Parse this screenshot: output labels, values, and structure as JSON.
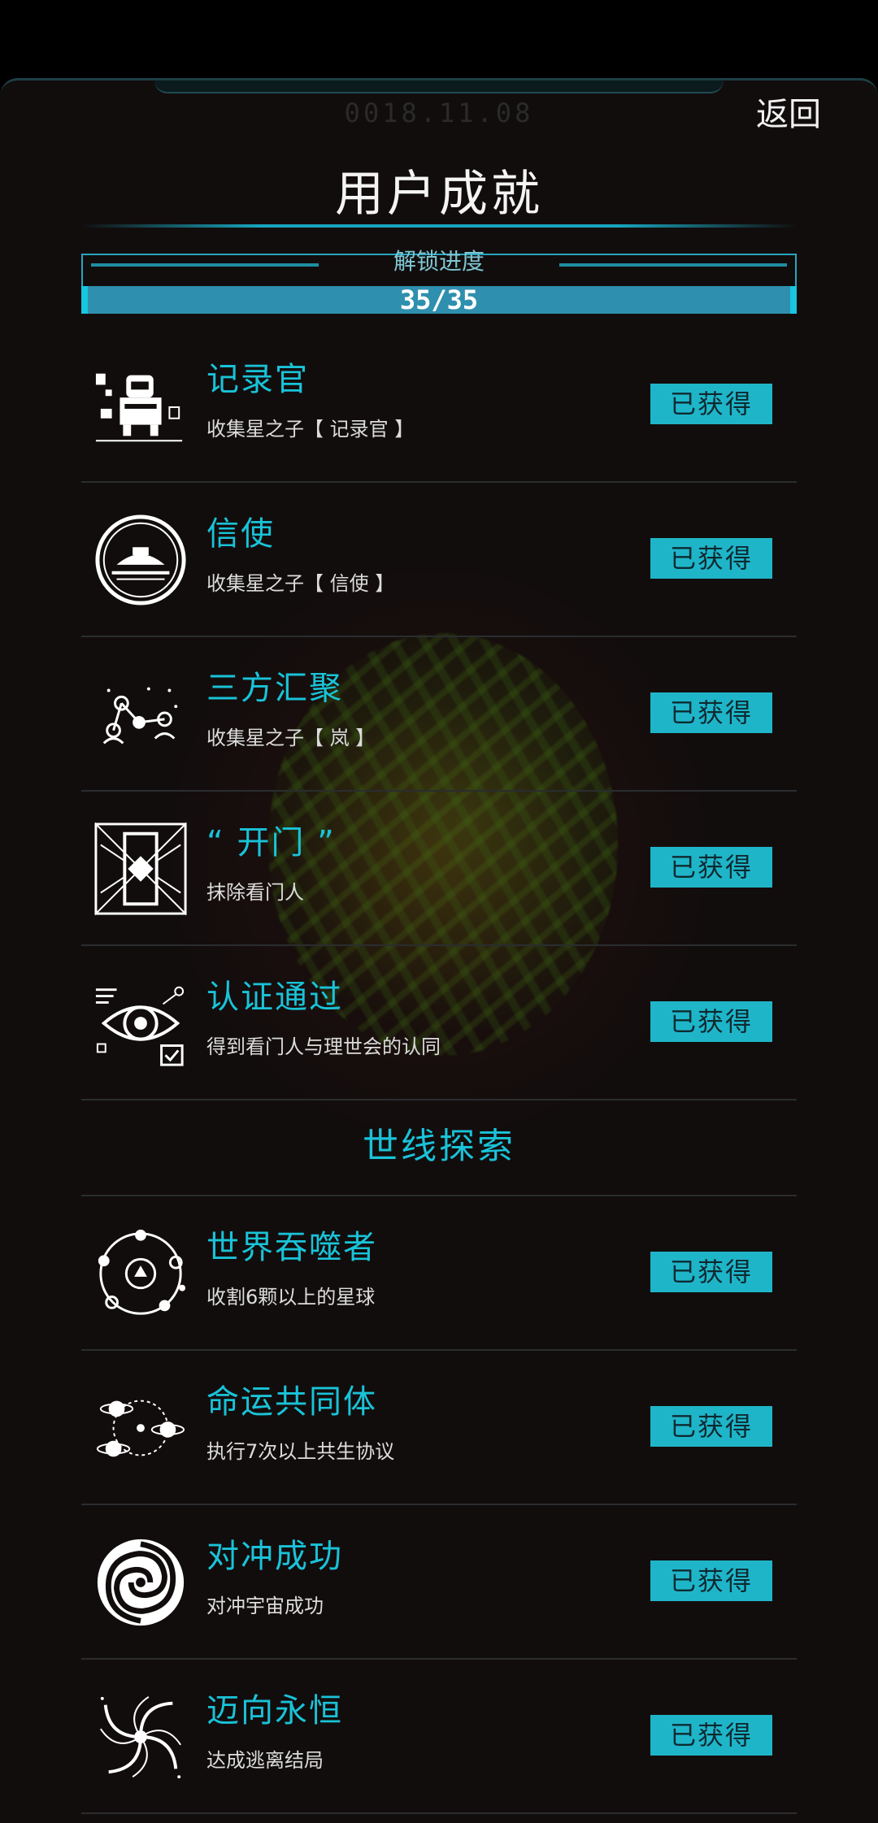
{
  "header": {
    "date": "0018.11.08",
    "back_label": "返回",
    "title": "用户成就"
  },
  "progress": {
    "label": "解锁进度",
    "text": "35/35",
    "unlocked": 35,
    "total": 35
  },
  "sections": [
    {
      "title": "",
      "items": [
        {
          "name": "记录官",
          "desc": "收集星之子【 记录官 】",
          "status": "已获得",
          "icon": "recorder-robot-icon"
        },
        {
          "name": "信使",
          "desc": "收集星之子【 信使 】",
          "status": "已获得",
          "icon": "messenger-ship-icon"
        },
        {
          "name": "三方汇聚",
          "desc": "收集星之子【 岚 】",
          "status": "已获得",
          "icon": "three-party-network-icon"
        },
        {
          "name": "“ 开门 ”",
          "desc": "抹除看门人",
          "status": "已获得",
          "icon": "open-gate-icon"
        },
        {
          "name": "认证通过",
          "desc": "得到看门人与理世会的认同",
          "status": "已获得",
          "icon": "verified-eye-icon"
        }
      ]
    },
    {
      "title": "世线探索",
      "items": [
        {
          "name": "世界吞噬者",
          "desc": "收割6颗以上的星球",
          "status": "已获得",
          "icon": "world-devourer-icon"
        },
        {
          "name": "命运共同体",
          "desc": "执行7次以上共生协议",
          "status": "已获得",
          "icon": "shared-destiny-icon"
        },
        {
          "name": "对冲成功",
          "desc": "对冲宇宙成功",
          "status": "已获得",
          "icon": "vortex-icon"
        },
        {
          "name": "迈向永恒",
          "desc": "达成逃离结局",
          "status": "已获得",
          "icon": "swirl-galaxy-icon"
        }
      ]
    }
  ],
  "colors": {
    "accent": "#19c3d8",
    "button_bg": "#1fb5c9",
    "background": "#120d0d"
  }
}
